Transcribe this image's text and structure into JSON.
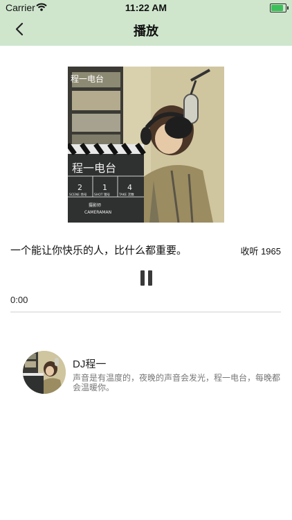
{
  "status_bar": {
    "carrier": "Carrier",
    "time": "11:22 AM",
    "battery_level": 1.0
  },
  "nav": {
    "title": "播放",
    "back_icon": "chevron-left-icon"
  },
  "cover": {
    "caption": "程一电台",
    "board_text": "程一电台",
    "board_cells": [
      "2",
      "1",
      "4",
      "SCENE 场号",
      "SHOT 镜号",
      "TAKE 次数",
      "摄影师",
      "CAMERAMAN"
    ]
  },
  "episode": {
    "quote": "一个能让你快乐的人，比什么都重要。",
    "listen_count": "收听 1965"
  },
  "player": {
    "elapsed": "0:00",
    "progress": 0.0,
    "control_icon": "pause-icon"
  },
  "host": {
    "name": "DJ程一",
    "description": "声音是有温度的，夜晚的声音会发光，程一电台，每晚都会温暖你。"
  },
  "colors": {
    "header_bg": "#cfe6cd",
    "battery_fill": "#3bc15a"
  }
}
